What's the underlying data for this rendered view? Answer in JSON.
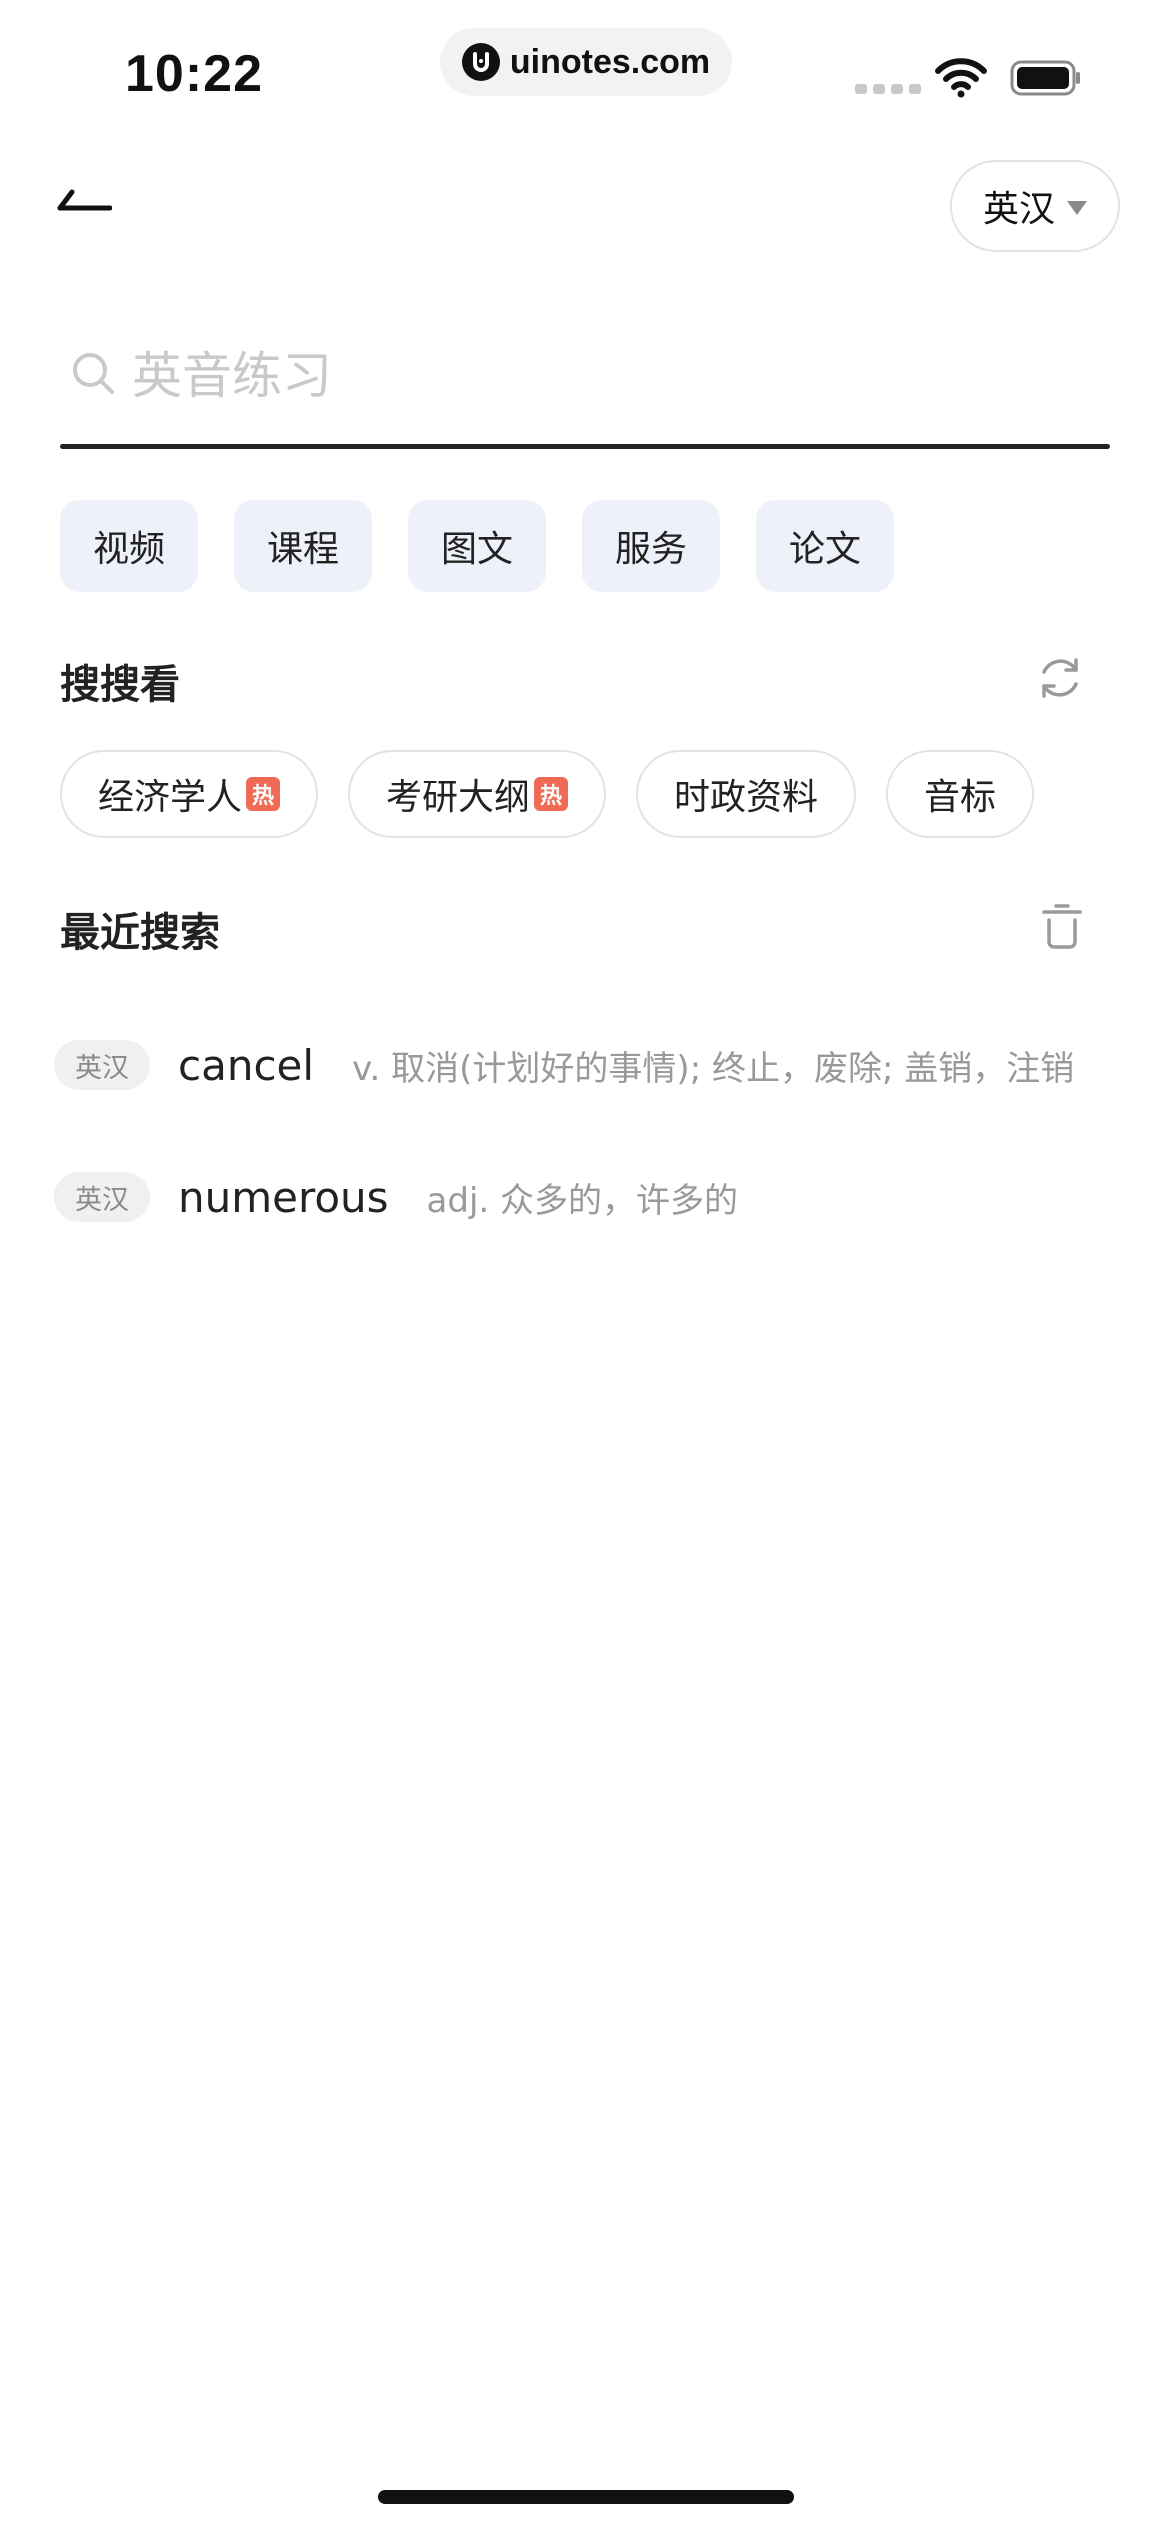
{
  "status_bar": {
    "time": "10:22",
    "url": "uinotes.com"
  },
  "header": {
    "lang_selector_label": "英汉"
  },
  "search": {
    "placeholder": "英音练习",
    "value": ""
  },
  "categories": [
    "视频",
    "课程",
    "图文",
    "服务",
    "论文"
  ],
  "suggest": {
    "title": "搜搜看",
    "items": [
      {
        "label": "经济学人",
        "hot": true,
        "badge": "热"
      },
      {
        "label": "考研大纲",
        "hot": true,
        "badge": "热"
      },
      {
        "label": "时政资料",
        "hot": false
      },
      {
        "label": "音标",
        "hot": false
      }
    ]
  },
  "recent": {
    "title": "最近搜索",
    "items": [
      {
        "tag": "英汉",
        "word": "cancel",
        "definition": "v. 取消(计划好的事情); 终止，废除; 盖销，注销"
      },
      {
        "tag": "英汉",
        "word": "numerous",
        "definition": "adj. 众多的，许多的"
      }
    ]
  },
  "colors": {
    "chip_bg": "#eef0fa",
    "hot_badge": "#f06a56",
    "placeholder": "#c9c9c9",
    "definition_text": "#999999"
  },
  "icons": [
    "back-arrow-icon",
    "caret-down-icon",
    "search-icon",
    "refresh-icon",
    "trash-icon",
    "wifi-icon",
    "battery-icon",
    "signal-icon"
  ]
}
